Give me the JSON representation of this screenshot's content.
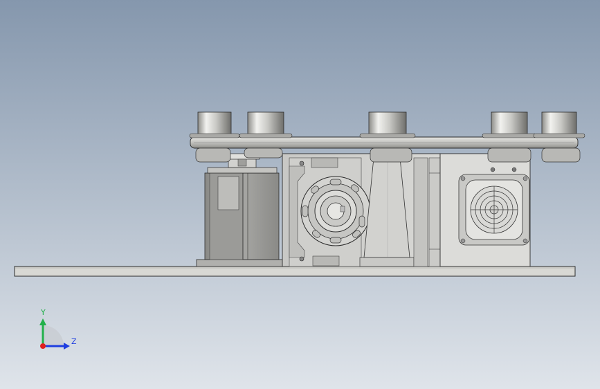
{
  "view": {
    "background_top": "#8597ad",
    "background_bottom": "#dfe4ea"
  },
  "triad": {
    "y_label": "Y",
    "z_label": "Z",
    "y_color": "#22b04a",
    "z_color": "#1f3ee0",
    "x_color": "#e02020"
  },
  "colors": {
    "metal_light": "#e8e8e6",
    "metal_mid": "#b9b9b6",
    "metal_dark": "#7a7a78",
    "plate": "#d6d6d2",
    "outline": "#2a2a2a"
  }
}
